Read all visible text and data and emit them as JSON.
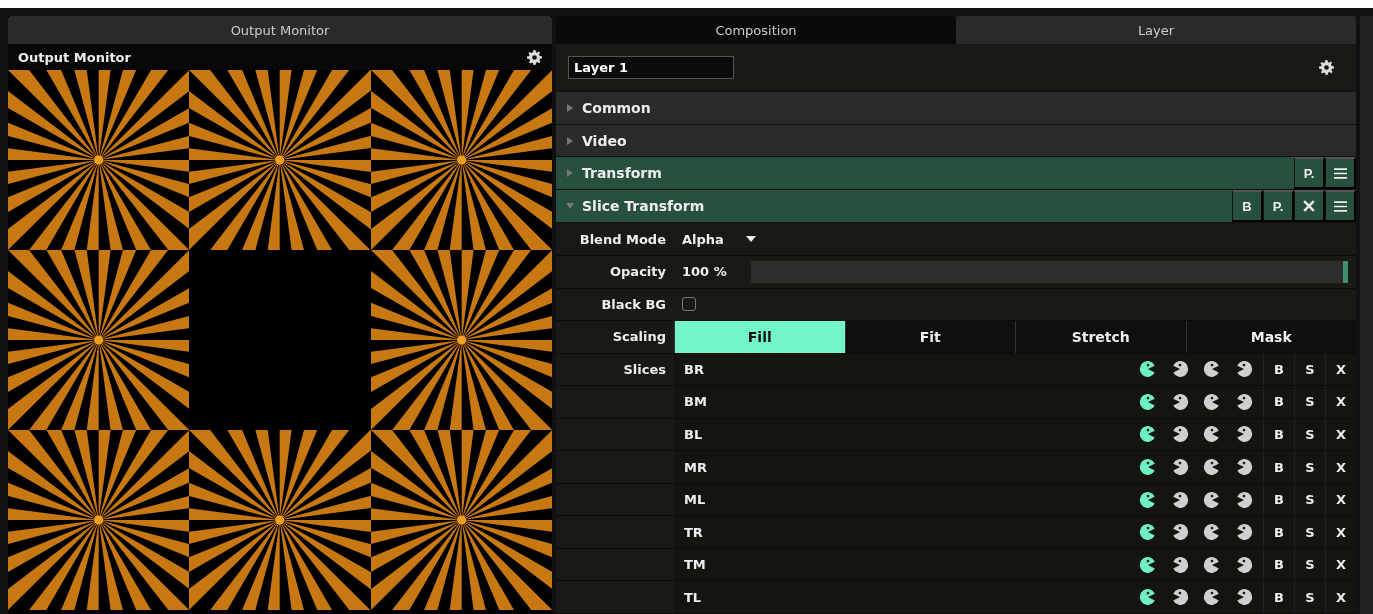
{
  "output_panel": {
    "tab": {
      "label": "Output Monitor",
      "selected": true
    },
    "title": "Output Monitor",
    "tiles": [
      {
        "kind": "starburst"
      },
      {
        "kind": "starburst"
      },
      {
        "kind": "starburst"
      },
      {
        "kind": "starburst"
      },
      {
        "kind": "empty"
      },
      {
        "kind": "starburst"
      },
      {
        "kind": "starburst"
      },
      {
        "kind": "starburst"
      },
      {
        "kind": "starburst"
      }
    ]
  },
  "layer_panel": {
    "tabs": [
      {
        "label": "Composition",
        "selected": false
      },
      {
        "label": "Layer",
        "selected": true
      }
    ],
    "layer_name": "Layer 1",
    "sections": [
      {
        "label": "Common",
        "expanded": false,
        "active": false
      },
      {
        "label": "Video",
        "expanded": false,
        "active": false
      },
      {
        "label": "Transform",
        "expanded": false,
        "active": true,
        "buttons": [
          {
            "kind": "text",
            "label": "P."
          },
          {
            "kind": "menu"
          }
        ]
      },
      {
        "label": "Slice Transform",
        "expanded": true,
        "active": true,
        "buttons": [
          {
            "kind": "text",
            "label": "B"
          },
          {
            "kind": "text",
            "label": "P."
          },
          {
            "kind": "close"
          },
          {
            "kind": "menu"
          }
        ]
      }
    ],
    "blend_mode": {
      "label": "Blend Mode",
      "value": "Alpha"
    },
    "opacity": {
      "label": "Opacity",
      "reading": "100 %",
      "level": 1.0
    },
    "black_bg": {
      "label": "Black BG",
      "checked": false
    },
    "scaling": {
      "label": "Scaling",
      "options": [
        {
          "label": "Fill",
          "selected": true
        },
        {
          "label": "Fit",
          "selected": false
        },
        {
          "label": "Stretch",
          "selected": false
        },
        {
          "label": "Mask",
          "selected": false
        }
      ]
    },
    "slices": {
      "label": "Slices",
      "rows": [
        {
          "name": "BR",
          "modes": [
            {
              "selected": true
            },
            {
              "selected": false
            },
            {
              "selected": false
            },
            {
              "selected": false
            }
          ],
          "buttons": [
            "B",
            "S",
            "X"
          ]
        },
        {
          "name": "BM",
          "modes": [
            {
              "selected": true
            },
            {
              "selected": false
            },
            {
              "selected": false
            },
            {
              "selected": false
            }
          ],
          "buttons": [
            "B",
            "S",
            "X"
          ]
        },
        {
          "name": "BL",
          "modes": [
            {
              "selected": true
            },
            {
              "selected": false
            },
            {
              "selected": false
            },
            {
              "selected": false
            }
          ],
          "buttons": [
            "B",
            "S",
            "X"
          ]
        },
        {
          "name": "MR",
          "modes": [
            {
              "selected": true
            },
            {
              "selected": false
            },
            {
              "selected": false
            },
            {
              "selected": false
            }
          ],
          "buttons": [
            "B",
            "S",
            "X"
          ]
        },
        {
          "name": "ML",
          "modes": [
            {
              "selected": true
            },
            {
              "selected": false
            },
            {
              "selected": false
            },
            {
              "selected": false
            }
          ],
          "buttons": [
            "B",
            "S",
            "X"
          ]
        },
        {
          "name": "TR",
          "modes": [
            {
              "selected": true
            },
            {
              "selected": false
            },
            {
              "selected": false
            },
            {
              "selected": false
            }
          ],
          "buttons": [
            "B",
            "S",
            "X"
          ]
        },
        {
          "name": "TM",
          "modes": [
            {
              "selected": true
            },
            {
              "selected": false
            },
            {
              "selected": false
            },
            {
              "selected": false
            }
          ],
          "buttons": [
            "B",
            "S",
            "X"
          ]
        },
        {
          "name": "TL",
          "modes": [
            {
              "selected": true
            },
            {
              "selected": false
            },
            {
              "selected": false
            },
            {
              "selected": false
            }
          ],
          "buttons": [
            "B",
            "S",
            "X"
          ]
        }
      ]
    }
  }
}
